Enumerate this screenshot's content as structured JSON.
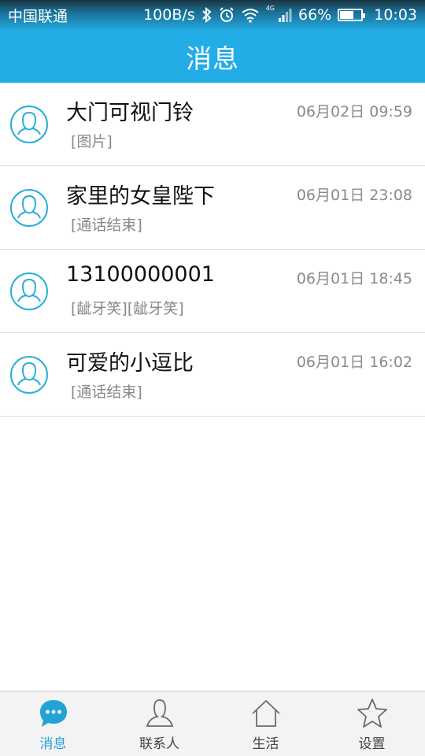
{
  "status_bar": {
    "carrier": "中国联通",
    "network_speed": "100B/s",
    "network_type": "4G",
    "battery": "66%",
    "battery_level": 0.66,
    "time": "10:03"
  },
  "header": {
    "title": "消息"
  },
  "messages": [
    {
      "name": "大门可视门铃",
      "time": "06月02日 09:59",
      "preview": "[图片]"
    },
    {
      "name": "家里的女皇陛下",
      "time": "06月01日 23:08",
      "preview": "[通话结束]"
    },
    {
      "name": "13100000001",
      "time": "06月01日 18:45",
      "preview": "[龇牙笑][龇牙笑]"
    },
    {
      "name": "可爱的小逗比",
      "time": "06月01日 16:02",
      "preview": "[通话结束]"
    }
  ],
  "bottom_nav": {
    "items": [
      {
        "label": "消息",
        "icon": "chat-bubble-icon",
        "active": true
      },
      {
        "label": "联系人",
        "icon": "contact-person-icon",
        "active": false
      },
      {
        "label": "生活",
        "icon": "home-icon",
        "active": false
      },
      {
        "label": "设置",
        "icon": "star-icon",
        "active": false
      }
    ]
  },
  "colors": {
    "accent": "#22ade6",
    "active_tab": "#22a3d8",
    "avatar_ring": "#2aaed9"
  }
}
